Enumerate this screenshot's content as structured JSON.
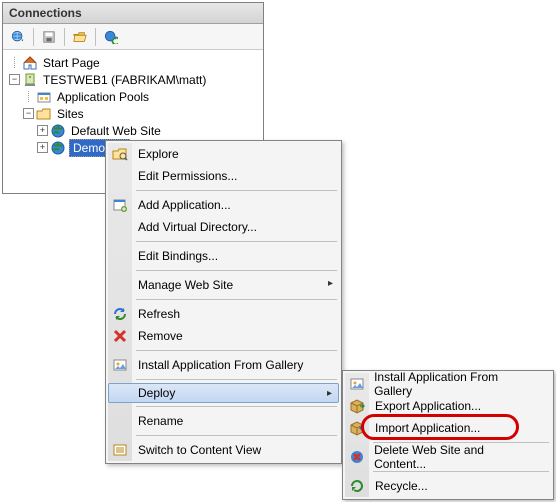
{
  "panel": {
    "title": "Connections"
  },
  "toolbar": {
    "connect": "Connect",
    "save": "Save",
    "up": "Up One Level",
    "refresh": "Refresh"
  },
  "tree": {
    "start_page": "Start Page",
    "server": "TESTWEB1 (FABRIKAM\\matt)",
    "app_pools": "Application Pools",
    "sites": "Sites",
    "default_site": "Default Web Site",
    "demo_site": "DemoSite"
  },
  "context_menu": {
    "explore": "Explore",
    "edit_permissions": "Edit Permissions...",
    "add_application": "Add Application...",
    "add_virtual_dir": "Add Virtual Directory...",
    "edit_bindings": "Edit Bindings...",
    "manage_web_site": "Manage Web Site",
    "refresh": "Refresh",
    "remove": "Remove",
    "install_from_gallery": "Install Application From Gallery",
    "deploy": "Deploy",
    "rename": "Rename",
    "switch_content_view": "Switch to Content View"
  },
  "deploy_submenu": {
    "install_from_gallery": "Install Application From Gallery",
    "export_application": "Export Application...",
    "import_application": "Import Application...",
    "delete_site_content": "Delete Web Site and Content...",
    "recycle": "Recycle..."
  },
  "icons": {
    "globe": "globe-icon",
    "disk": "disk-icon",
    "folder_open": "folder-open-icon",
    "refresh_globe": "refresh-globe-icon",
    "home": "home-icon",
    "server": "server-icon",
    "earth": "earth-icon",
    "folder_search": "folder-search-icon",
    "app": "app-icon",
    "vdir": "vdir-icon",
    "refresh": "refresh-arrows-icon",
    "remove": "remove-x-icon",
    "gallery": "gallery-icon",
    "package": "package-icon",
    "package_in": "package-import-icon",
    "delete": "delete-icon",
    "recycle": "recycle-icon",
    "content": "content-view-icon"
  }
}
